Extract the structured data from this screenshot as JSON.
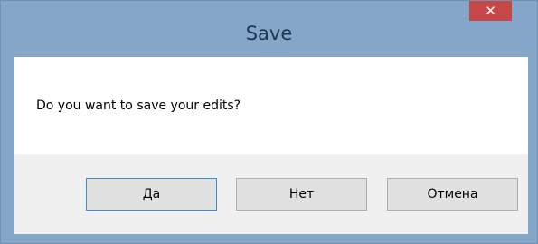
{
  "window": {
    "title": "Save",
    "close_glyph": "✕"
  },
  "dialog": {
    "message": "Do you want to save your edits?"
  },
  "buttons": {
    "yes_label": "Да",
    "no_label": "Нет",
    "cancel_label": "Отмена"
  },
  "colors": {
    "frame": "#84a6c9",
    "close_button": "#c74848",
    "default_button_border": "#3c8bdc"
  }
}
